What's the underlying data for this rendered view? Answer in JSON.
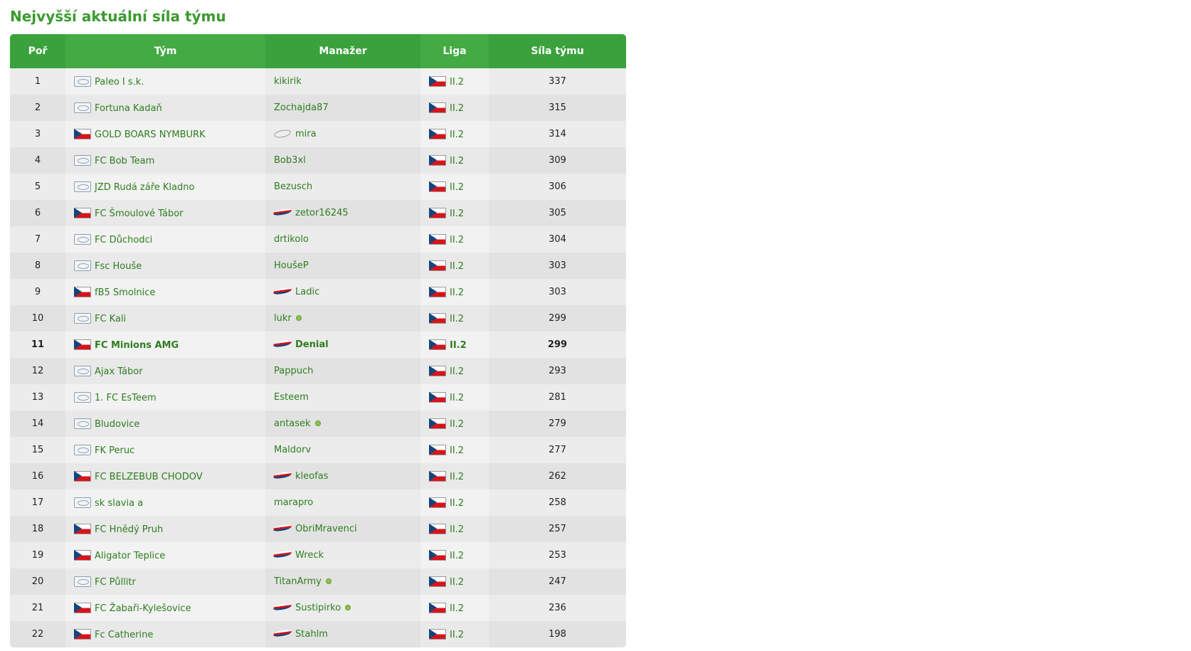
{
  "title": "Nejvyšší aktuální síla týmu",
  "headers": {
    "pos": "Poř",
    "team": "Tým",
    "manager": "Manažer",
    "liga": "Liga",
    "sila": "Síla týmu"
  },
  "colors": {
    "accent": "#3aa23c",
    "link": "#2e7d1f"
  },
  "rows": [
    {
      "pos": "1",
      "team": "Paleo I s.k.",
      "team_flag": "generic",
      "manager": "kikirik",
      "manager_flag": "none",
      "online": false,
      "liga": "II.2",
      "sila": "337",
      "bold": false
    },
    {
      "pos": "2",
      "team": "Fortuna Kadaň",
      "team_flag": "generic",
      "manager": "Zochajda87",
      "manager_flag": "none",
      "online": false,
      "liga": "II.2",
      "sila": "315",
      "bold": false
    },
    {
      "pos": "3",
      "team": "GOLD BOARS NYMBURK",
      "team_flag": "cz",
      "manager": "mira",
      "manager_flag": "gen",
      "online": false,
      "liga": "II.2",
      "sila": "314",
      "bold": false
    },
    {
      "pos": "4",
      "team": "FC Bob Team",
      "team_flag": "generic",
      "manager": "Bob3xl",
      "manager_flag": "none",
      "online": false,
      "liga": "II.2",
      "sila": "309",
      "bold": false
    },
    {
      "pos": "5",
      "team": "JZD Rudá záře Kladno",
      "team_flag": "generic",
      "manager": "Bezusch",
      "manager_flag": "none",
      "online": false,
      "liga": "II.2",
      "sila": "306",
      "bold": false
    },
    {
      "pos": "6",
      "team": "FC Šmoulové Tábor",
      "team_flag": "cz",
      "manager": "zetor16245",
      "manager_flag": "cz",
      "online": false,
      "liga": "II.2",
      "sila": "305",
      "bold": false
    },
    {
      "pos": "7",
      "team": "FC Důchodci",
      "team_flag": "generic",
      "manager": "drtikolo",
      "manager_flag": "none",
      "online": false,
      "liga": "II.2",
      "sila": "304",
      "bold": false
    },
    {
      "pos": "8",
      "team": "Fsc Houše",
      "team_flag": "generic",
      "manager": "HoušeP",
      "manager_flag": "none",
      "online": false,
      "liga": "II.2",
      "sila": "303",
      "bold": false
    },
    {
      "pos": "9",
      "team": "fB5 Smolnice",
      "team_flag": "cz",
      "manager": "Ladic",
      "manager_flag": "cz",
      "online": false,
      "liga": "II.2",
      "sila": "303",
      "bold": false
    },
    {
      "pos": "10",
      "team": "FC Kali",
      "team_flag": "generic",
      "manager": "lukr",
      "manager_flag": "none",
      "online": true,
      "liga": "II.2",
      "sila": "299",
      "bold": false
    },
    {
      "pos": "11",
      "team": "FC Minions AMG",
      "team_flag": "cz",
      "manager": "Denial",
      "manager_flag": "cz",
      "online": false,
      "liga": "II.2",
      "sila": "299",
      "bold": true
    },
    {
      "pos": "12",
      "team": "Ajax Tábor",
      "team_flag": "generic",
      "manager": "Pappuch",
      "manager_flag": "none",
      "online": false,
      "liga": "II.2",
      "sila": "293",
      "bold": false
    },
    {
      "pos": "13",
      "team": "1. FC EsTeem",
      "team_flag": "generic",
      "manager": "Esteem",
      "manager_flag": "none",
      "online": false,
      "liga": "II.2",
      "sila": "281",
      "bold": false
    },
    {
      "pos": "14",
      "team": "Bludovice",
      "team_flag": "generic",
      "manager": "antasek",
      "manager_flag": "none",
      "online": true,
      "liga": "II.2",
      "sila": "279",
      "bold": false
    },
    {
      "pos": "15",
      "team": "FK Peruc",
      "team_flag": "generic",
      "manager": "Maldorv",
      "manager_flag": "none",
      "online": false,
      "liga": "II.2",
      "sila": "277",
      "bold": false
    },
    {
      "pos": "16",
      "team": "FC BELZEBUB CHODOV",
      "team_flag": "cz",
      "manager": "kleofas",
      "manager_flag": "cz",
      "online": false,
      "liga": "II.2",
      "sila": "262",
      "bold": false
    },
    {
      "pos": "17",
      "team": "sk slavia a",
      "team_flag": "generic",
      "manager": "marapro",
      "manager_flag": "none",
      "online": false,
      "liga": "II.2",
      "sila": "258",
      "bold": false
    },
    {
      "pos": "18",
      "team": "FC Hnědý Pruh",
      "team_flag": "cz",
      "manager": "ObriMravenci",
      "manager_flag": "cz",
      "online": false,
      "liga": "II.2",
      "sila": "257",
      "bold": false
    },
    {
      "pos": "19",
      "team": "Aligator Teplice",
      "team_flag": "cz",
      "manager": "Wreck",
      "manager_flag": "cz",
      "online": false,
      "liga": "II.2",
      "sila": "253",
      "bold": false
    },
    {
      "pos": "20",
      "team": "FC Půllitr",
      "team_flag": "generic",
      "manager": "TitanArmy",
      "manager_flag": "none",
      "online": true,
      "liga": "II.2",
      "sila": "247",
      "bold": false
    },
    {
      "pos": "21",
      "team": "FC Žabaři-Kylešovice",
      "team_flag": "cz",
      "manager": "Sustipirko",
      "manager_flag": "cz",
      "online": true,
      "liga": "II.2",
      "sila": "236",
      "bold": false
    },
    {
      "pos": "22",
      "team": "Fc Catherine",
      "team_flag": "cz",
      "manager": "Stahlm",
      "manager_flag": "cz",
      "online": false,
      "liga": "II.2",
      "sila": "198",
      "bold": false
    }
  ]
}
